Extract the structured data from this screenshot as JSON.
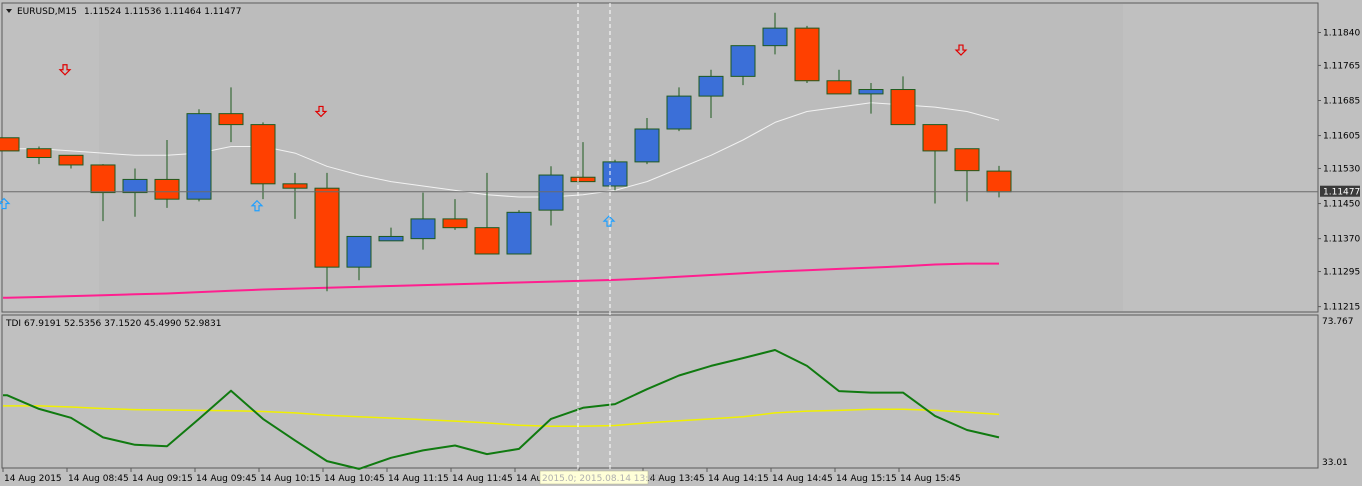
{
  "main_header": {
    "symbol": "EURUSD,M15",
    "ohlc": "1.11524 1.11536 1.11464 1.11477"
  },
  "indicator_header": {
    "text": "TDI 67.9191 52.5356 37.1520 45.4990 52.9831"
  },
  "price_axis": {
    "ticks": [
      "1.11840",
      "1.11765",
      "1.11685",
      "1.11605",
      "1.11530",
      "1.11450",
      "1.11370",
      "1.11295",
      "1.11215"
    ],
    "current_price_label": "1.11477"
  },
  "indicator_axis": {
    "ticks": [
      "73.767",
      "33.01"
    ]
  },
  "time_axis": {
    "labels": [
      "14 Aug 2015",
      "14 Aug 08:45",
      "14 Aug 09:15",
      "14 Aug 09:45",
      "14 Aug 10:15",
      "14 Aug 10:45",
      "14 Aug 11:15",
      "14 Aug 11:45",
      "14 Aug",
      "14 Aug 13:15",
      "14 Aug 13:45",
      "14 Aug 14:15",
      "14 Aug 14:45",
      "14 Aug 15:15",
      "14 Aug 15:45"
    ],
    "crosshair_label": "2015.0; 2015.08.14 13:00"
  },
  "colors": {
    "bull": "#3b6fd8",
    "bear": "#ff4000",
    "wick": "#1e5a1e",
    "ma_fast": "#f2f2f2",
    "ma_slow": "#ff1f8f",
    "tdi_green": "#107a10",
    "tdi_yellow": "#f0f000",
    "sell_arrow": "#e00000",
    "buy_arrow": "#20a0ff"
  },
  "chart_data": [
    {
      "type": "candlestick",
      "symbol": "EURUSD",
      "timeframe": "M15",
      "ylim": [
        1.11205,
        1.11905
      ],
      "candles": [
        {
          "o": 1.116,
          "h": 1.116,
          "l": 1.1157,
          "c": 1.1157
        },
        {
          "o": 1.11575,
          "h": 1.1158,
          "l": 1.1154,
          "c": 1.11555
        },
        {
          "o": 1.1156,
          "h": 1.1156,
          "l": 1.1153,
          "c": 1.11538
        },
        {
          "o": 1.11538,
          "h": 1.1154,
          "l": 1.1141,
          "c": 1.11475
        },
        {
          "o": 1.11475,
          "h": 1.1153,
          "l": 1.1142,
          "c": 1.11505
        },
        {
          "o": 1.11505,
          "h": 1.11595,
          "l": 1.1144,
          "c": 1.1146
        },
        {
          "o": 1.1146,
          "h": 1.11665,
          "l": 1.11455,
          "c": 1.11655
        },
        {
          "o": 1.11655,
          "h": 1.11715,
          "l": 1.1159,
          "c": 1.1163
        },
        {
          "o": 1.1163,
          "h": 1.11635,
          "l": 1.1146,
          "c": 1.11495
        },
        {
          "o": 1.11495,
          "h": 1.1152,
          "l": 1.11415,
          "c": 1.11485
        },
        {
          "o": 1.11485,
          "h": 1.1152,
          "l": 1.1125,
          "c": 1.11305
        },
        {
          "o": 1.11305,
          "h": 1.1137,
          "l": 1.11275,
          "c": 1.11375
        },
        {
          "o": 1.11365,
          "h": 1.11395,
          "l": 1.11365,
          "c": 1.11375
        },
        {
          "o": 1.1137,
          "h": 1.11475,
          "l": 1.11345,
          "c": 1.11415
        },
        {
          "o": 1.11415,
          "h": 1.1146,
          "l": 1.1139,
          "c": 1.11395
        },
        {
          "o": 1.11395,
          "h": 1.1152,
          "l": 1.11335,
          "c": 1.11335
        },
        {
          "o": 1.11335,
          "h": 1.11435,
          "l": 1.11335,
          "c": 1.1143
        },
        {
          "o": 1.11435,
          "h": 1.11535,
          "l": 1.114,
          "c": 1.11515
        },
        {
          "o": 1.1151,
          "h": 1.1159,
          "l": 1.115,
          "c": 1.115
        },
        {
          "o": 1.1149,
          "h": 1.1155,
          "l": 1.1148,
          "c": 1.11545
        },
        {
          "o": 1.11545,
          "h": 1.11645,
          "l": 1.1154,
          "c": 1.1162
        },
        {
          "o": 1.1162,
          "h": 1.11715,
          "l": 1.11615,
          "c": 1.11695
        },
        {
          "o": 1.11695,
          "h": 1.11755,
          "l": 1.11645,
          "c": 1.1174
        },
        {
          "o": 1.1174,
          "h": 1.118,
          "l": 1.1172,
          "c": 1.1181
        },
        {
          "o": 1.1181,
          "h": 1.11885,
          "l": 1.1179,
          "c": 1.1185
        },
        {
          "o": 1.1185,
          "h": 1.11855,
          "l": 1.11725,
          "c": 1.1173
        },
        {
          "o": 1.1173,
          "h": 1.11755,
          "l": 1.117,
          "c": 1.117
        },
        {
          "o": 1.117,
          "h": 1.11725,
          "l": 1.11655,
          "c": 1.1171
        },
        {
          "o": 1.1171,
          "h": 1.1174,
          "l": 1.1163,
          "c": 1.1163
        },
        {
          "o": 1.1163,
          "h": 1.1163,
          "l": 1.1145,
          "c": 1.1157
        },
        {
          "o": 1.11575,
          "h": 1.11575,
          "l": 1.11455,
          "c": 1.11525
        },
        {
          "o": 1.11524,
          "h": 1.11536,
          "l": 1.11464,
          "c": 1.11477
        }
      ],
      "ma_fast": [
        1.11575,
        1.11575,
        1.1157,
        1.11565,
        1.1156,
        1.1156,
        1.11565,
        1.1158,
        1.1158,
        1.11565,
        1.11535,
        1.11515,
        1.115,
        1.1149,
        1.1148,
        1.1147,
        1.11465,
        1.11465,
        1.1147,
        1.1148,
        1.115,
        1.1153,
        1.1156,
        1.11595,
        1.11635,
        1.1166,
        1.1167,
        1.1168,
        1.11675,
        1.1167,
        1.1166,
        1.1164
      ],
      "ma_slow": [
        1.11235,
        1.11237,
        1.11239,
        1.11241,
        1.11243,
        1.11245,
        1.11248,
        1.11251,
        1.11254,
        1.11256,
        1.11258,
        1.1126,
        1.11262,
        1.11264,
        1.11266,
        1.11268,
        1.1127,
        1.11272,
        1.11274,
        1.11276,
        1.11279,
        1.11283,
        1.11287,
        1.11291,
        1.11295,
        1.11298,
        1.11301,
        1.11304,
        1.11307,
        1.11311,
        1.11313,
        1.11313
      ],
      "current_price": 1.11477,
      "sell_arrows": [
        {
          "i": 1,
          "p": 1.11755
        },
        {
          "i": 9,
          "p": 1.1166
        },
        {
          "i": 29,
          "p": 1.118
        }
      ],
      "buy_arrows": [
        {
          "i": 0,
          "p": 1.1145
        },
        {
          "i": 7,
          "p": 1.11445
        },
        {
          "i": 18,
          "p": 1.1141
        }
      ],
      "crosshair_candles": [
        18,
        19
      ]
    },
    {
      "type": "line",
      "title": "TDI",
      "ylim": [
        33.01,
        73.767
      ],
      "series": [
        {
          "color": "#107a10",
          "values": [
            52.4,
            48.7,
            46.3,
            41.0,
            39.0,
            38.6,
            46.0,
            53.6,
            46.0,
            40.2,
            34.6,
            32.5,
            35.5,
            37.5,
            38.8,
            36.5,
            37.9,
            46.0,
            49.0,
            50.0,
            54.0,
            57.7,
            60.3,
            62.4,
            64.6,
            60.3,
            53.5,
            53.1,
            53.1,
            46.8,
            43.0,
            41.0
          ]
        },
        {
          "color": "#f0f000",
          "values": [
            49.5,
            49.5,
            49.2,
            48.8,
            48.5,
            48.4,
            48.3,
            48.2,
            48.0,
            47.6,
            47.0,
            46.6,
            46.2,
            45.8,
            45.4,
            44.9,
            44.3,
            44.0,
            44.0,
            44.2,
            44.9,
            45.5,
            46.0,
            46.6,
            47.6,
            48.1,
            48.3,
            48.6,
            48.6,
            48.3,
            47.8,
            47.2
          ]
        }
      ]
    }
  ]
}
